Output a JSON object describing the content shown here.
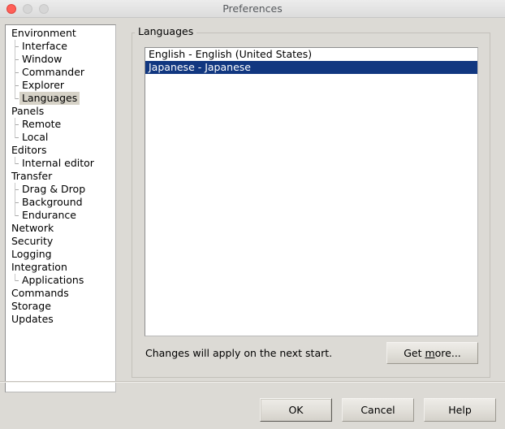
{
  "window": {
    "title": "Preferences",
    "traffic_lights": {
      "close": "close-button",
      "minimize": "minimize-button",
      "maximize": "maximize-button"
    }
  },
  "sidebar": {
    "items": [
      {
        "label": "Environment",
        "level": 0,
        "selected": false
      },
      {
        "label": "Interface",
        "level": 1,
        "selected": false
      },
      {
        "label": "Window",
        "level": 1,
        "selected": false
      },
      {
        "label": "Commander",
        "level": 1,
        "selected": false
      },
      {
        "label": "Explorer",
        "level": 1,
        "selected": false
      },
      {
        "label": "Languages",
        "level": 1,
        "selected": true
      },
      {
        "label": "Panels",
        "level": 0,
        "selected": false
      },
      {
        "label": "Remote",
        "level": 1,
        "selected": false
      },
      {
        "label": "Local",
        "level": 1,
        "selected": false
      },
      {
        "label": "Editors",
        "level": 0,
        "selected": false
      },
      {
        "label": "Internal editor",
        "level": 1,
        "selected": false
      },
      {
        "label": "Transfer",
        "level": 0,
        "selected": false
      },
      {
        "label": "Drag & Drop",
        "level": 1,
        "selected": false
      },
      {
        "label": "Background",
        "level": 1,
        "selected": false
      },
      {
        "label": "Endurance",
        "level": 1,
        "selected": false
      },
      {
        "label": "Network",
        "level": 0,
        "selected": false
      },
      {
        "label": "Security",
        "level": 0,
        "selected": false
      },
      {
        "label": "Logging",
        "level": 0,
        "selected": false
      },
      {
        "label": "Integration",
        "level": 0,
        "selected": false
      },
      {
        "label": "Applications",
        "level": 1,
        "selected": false
      },
      {
        "label": "Commands",
        "level": 0,
        "selected": false
      },
      {
        "label": "Storage",
        "level": 0,
        "selected": false
      },
      {
        "label": "Updates",
        "level": 0,
        "selected": false
      }
    ]
  },
  "main": {
    "group_title": "Languages",
    "languages": [
      {
        "label": "English - English (United States)",
        "selected": false
      },
      {
        "label": "Japanese - Japanese",
        "selected": true
      }
    ],
    "note": "Changes will apply on the next start.",
    "get_more_label": "Get ",
    "get_more_mnemonic": "m",
    "get_more_label_rest": "ore..."
  },
  "footer": {
    "ok_label": "OK",
    "cancel_label": "Cancel",
    "help_label": "Help"
  },
  "colors": {
    "dialog_background": "#dcdad5",
    "selection_blue": "#113780",
    "tree_selection_gray": "#d6d2c7",
    "titlebar": "#e6e6e6",
    "close_red": "#ff5f57",
    "inactive_gray": "#d6d6d6"
  }
}
